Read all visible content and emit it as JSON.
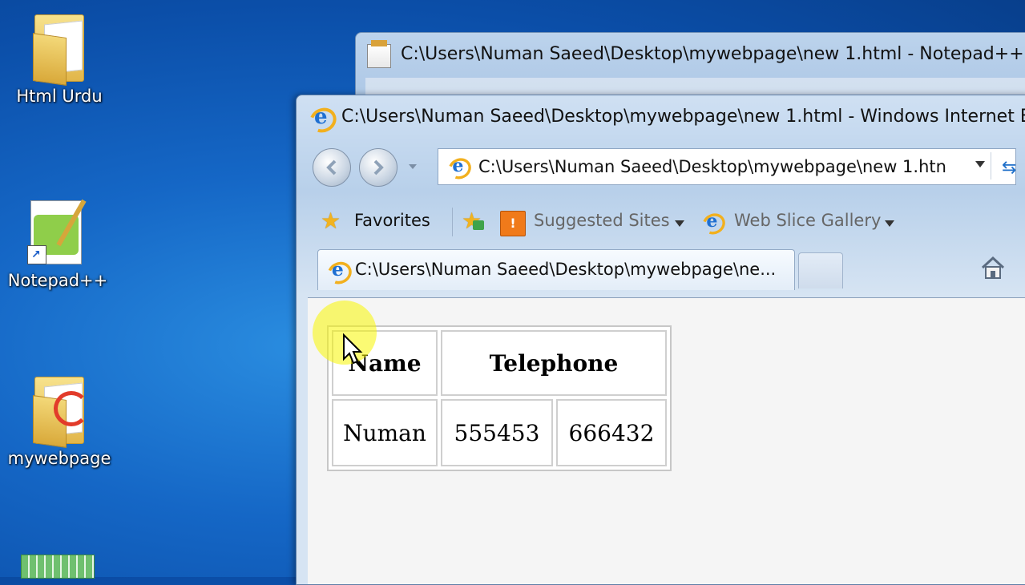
{
  "desktop": {
    "icons": [
      {
        "label": "Html Urdu"
      },
      {
        "label": "Notepad++"
      },
      {
        "label": "mywebpage"
      }
    ]
  },
  "notepad_window": {
    "title": "C:\\Users\\Numan Saeed\\Desktop\\mywebpage\\new  1.html - Notepad++"
  },
  "ie_window": {
    "title": "C:\\Users\\Numan Saeed\\Desktop\\mywebpage\\new  1.html - Windows Internet Ex",
    "address": "C:\\Users\\Numan Saeed\\Desktop\\mywebpage\\new  1.htn",
    "favorites": {
      "favorites_label": "Favorites",
      "suggested_sites_label": "Suggested Sites",
      "web_slice_gallery_label": "Web Slice Gallery"
    },
    "tab_title": "C:\\Users\\Numan Saeed\\Desktop\\mywebpage\\ne...",
    "page_table": {
      "headers": [
        "Name",
        "Telephone"
      ],
      "rows": [
        [
          "Numan",
          "555453",
          "666432"
        ]
      ]
    }
  }
}
